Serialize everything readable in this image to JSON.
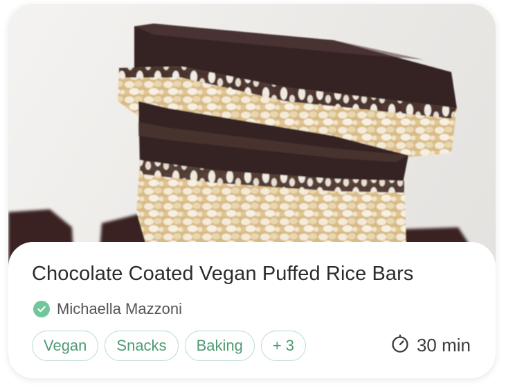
{
  "recipe": {
    "title": "Chocolate Coated Vegan Puffed Rice Bars",
    "author": "Michaella Mazzoni",
    "tags": [
      "Vegan",
      "Snacks",
      "Baking"
    ],
    "more_tags": "+ 3",
    "time": "30 min"
  },
  "icons": {
    "verified": "verified-check-icon",
    "time": "timer-icon"
  },
  "colors": {
    "accent": "#6fc79b",
    "tag_text": "#4e9a72",
    "tag_border": "#b9dcc9",
    "chocolate": "#3a2320"
  }
}
